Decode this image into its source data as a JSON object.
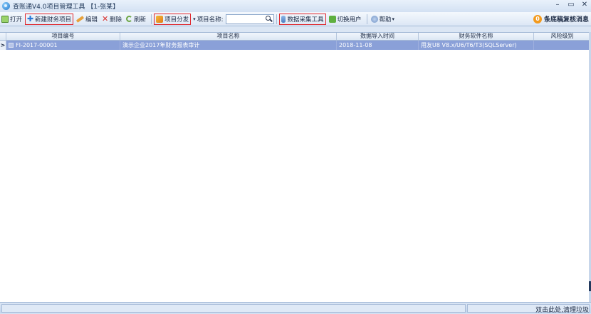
{
  "window": {
    "title": "查账通V4.0项目管理工具 【1-张某】",
    "controls": {
      "minimize": "–",
      "maximize": "▭",
      "close": "✕"
    }
  },
  "toolbar": {
    "open": "打开",
    "new_project": "新建财务项目",
    "edit": "编辑",
    "delete": "删除",
    "refresh": "刷新",
    "distribute": "项目分发",
    "name_label": "项目名称:",
    "search_value": "",
    "collect_tool": "数据采集工具",
    "switch_user": "切换用户",
    "help": "帮助"
  },
  "notification": {
    "count": "0",
    "text": "条底稿复核消息"
  },
  "grid": {
    "columns": [
      "项目编号",
      "项目名称",
      "数据导入时间",
      "财务软件名称",
      "风险级别"
    ],
    "rows": [
      {
        "indicator": ">",
        "id": "FI-2017-00001",
        "name": "演示企业2017年财务报表审计",
        "import_time": "2018-11-08",
        "software": "用友U8 V8.x/U6/T6/T3(SQLServer)",
        "risk": ""
      }
    ]
  },
  "status": {
    "text": "双击此处,清理垃圾"
  },
  "colors": {
    "highlight_border": "#e0252b",
    "selected_row": "#8aa0d8",
    "badge": "#f39a1d"
  }
}
